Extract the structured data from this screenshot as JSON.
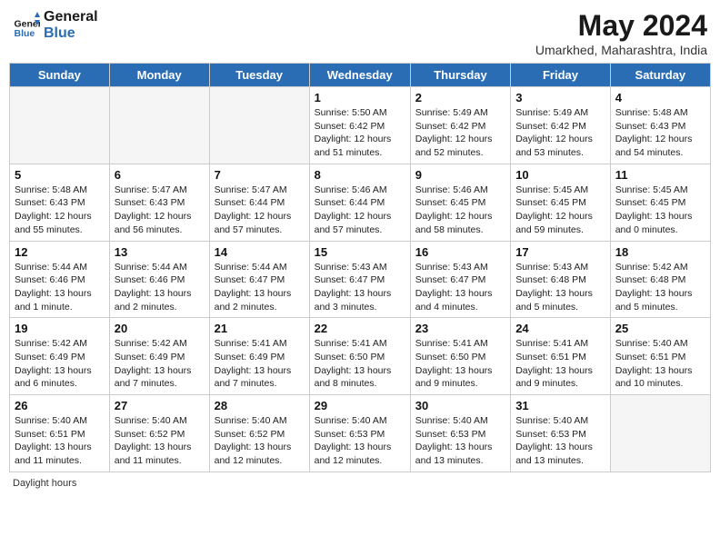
{
  "header": {
    "logo_line1": "General",
    "logo_line2": "Blue",
    "month": "May 2024",
    "location": "Umarkhed, Maharashtra, India"
  },
  "weekdays": [
    "Sunday",
    "Monday",
    "Tuesday",
    "Wednesday",
    "Thursday",
    "Friday",
    "Saturday"
  ],
  "weeks": [
    [
      {
        "day": "",
        "info": ""
      },
      {
        "day": "",
        "info": ""
      },
      {
        "day": "",
        "info": ""
      },
      {
        "day": "1",
        "info": "Sunrise: 5:50 AM\nSunset: 6:42 PM\nDaylight: 12 hours\nand 51 minutes."
      },
      {
        "day": "2",
        "info": "Sunrise: 5:49 AM\nSunset: 6:42 PM\nDaylight: 12 hours\nand 52 minutes."
      },
      {
        "day": "3",
        "info": "Sunrise: 5:49 AM\nSunset: 6:42 PM\nDaylight: 12 hours\nand 53 minutes."
      },
      {
        "day": "4",
        "info": "Sunrise: 5:48 AM\nSunset: 6:43 PM\nDaylight: 12 hours\nand 54 minutes."
      }
    ],
    [
      {
        "day": "5",
        "info": "Sunrise: 5:48 AM\nSunset: 6:43 PM\nDaylight: 12 hours\nand 55 minutes."
      },
      {
        "day": "6",
        "info": "Sunrise: 5:47 AM\nSunset: 6:43 PM\nDaylight: 12 hours\nand 56 minutes."
      },
      {
        "day": "7",
        "info": "Sunrise: 5:47 AM\nSunset: 6:44 PM\nDaylight: 12 hours\nand 57 minutes."
      },
      {
        "day": "8",
        "info": "Sunrise: 5:46 AM\nSunset: 6:44 PM\nDaylight: 12 hours\nand 57 minutes."
      },
      {
        "day": "9",
        "info": "Sunrise: 5:46 AM\nSunset: 6:45 PM\nDaylight: 12 hours\nand 58 minutes."
      },
      {
        "day": "10",
        "info": "Sunrise: 5:45 AM\nSunset: 6:45 PM\nDaylight: 12 hours\nand 59 minutes."
      },
      {
        "day": "11",
        "info": "Sunrise: 5:45 AM\nSunset: 6:45 PM\nDaylight: 13 hours\nand 0 minutes."
      }
    ],
    [
      {
        "day": "12",
        "info": "Sunrise: 5:44 AM\nSunset: 6:46 PM\nDaylight: 13 hours\nand 1 minute."
      },
      {
        "day": "13",
        "info": "Sunrise: 5:44 AM\nSunset: 6:46 PM\nDaylight: 13 hours\nand 2 minutes."
      },
      {
        "day": "14",
        "info": "Sunrise: 5:44 AM\nSunset: 6:47 PM\nDaylight: 13 hours\nand 2 minutes."
      },
      {
        "day": "15",
        "info": "Sunrise: 5:43 AM\nSunset: 6:47 PM\nDaylight: 13 hours\nand 3 minutes."
      },
      {
        "day": "16",
        "info": "Sunrise: 5:43 AM\nSunset: 6:47 PM\nDaylight: 13 hours\nand 4 minutes."
      },
      {
        "day": "17",
        "info": "Sunrise: 5:43 AM\nSunset: 6:48 PM\nDaylight: 13 hours\nand 5 minutes."
      },
      {
        "day": "18",
        "info": "Sunrise: 5:42 AM\nSunset: 6:48 PM\nDaylight: 13 hours\nand 5 minutes."
      }
    ],
    [
      {
        "day": "19",
        "info": "Sunrise: 5:42 AM\nSunset: 6:49 PM\nDaylight: 13 hours\nand 6 minutes."
      },
      {
        "day": "20",
        "info": "Sunrise: 5:42 AM\nSunset: 6:49 PM\nDaylight: 13 hours\nand 7 minutes."
      },
      {
        "day": "21",
        "info": "Sunrise: 5:41 AM\nSunset: 6:49 PM\nDaylight: 13 hours\nand 7 minutes."
      },
      {
        "day": "22",
        "info": "Sunrise: 5:41 AM\nSunset: 6:50 PM\nDaylight: 13 hours\nand 8 minutes."
      },
      {
        "day": "23",
        "info": "Sunrise: 5:41 AM\nSunset: 6:50 PM\nDaylight: 13 hours\nand 9 minutes."
      },
      {
        "day": "24",
        "info": "Sunrise: 5:41 AM\nSunset: 6:51 PM\nDaylight: 13 hours\nand 9 minutes."
      },
      {
        "day": "25",
        "info": "Sunrise: 5:40 AM\nSunset: 6:51 PM\nDaylight: 13 hours\nand 10 minutes."
      }
    ],
    [
      {
        "day": "26",
        "info": "Sunrise: 5:40 AM\nSunset: 6:51 PM\nDaylight: 13 hours\nand 11 minutes."
      },
      {
        "day": "27",
        "info": "Sunrise: 5:40 AM\nSunset: 6:52 PM\nDaylight: 13 hours\nand 11 minutes."
      },
      {
        "day": "28",
        "info": "Sunrise: 5:40 AM\nSunset: 6:52 PM\nDaylight: 13 hours\nand 12 minutes."
      },
      {
        "day": "29",
        "info": "Sunrise: 5:40 AM\nSunset: 6:53 PM\nDaylight: 13 hours\nand 12 minutes."
      },
      {
        "day": "30",
        "info": "Sunrise: 5:40 AM\nSunset: 6:53 PM\nDaylight: 13 hours\nand 13 minutes."
      },
      {
        "day": "31",
        "info": "Sunrise: 5:40 AM\nSunset: 6:53 PM\nDaylight: 13 hours\nand 13 minutes."
      },
      {
        "day": "",
        "info": ""
      }
    ]
  ],
  "footer": {
    "daylight_label": "Daylight hours"
  }
}
